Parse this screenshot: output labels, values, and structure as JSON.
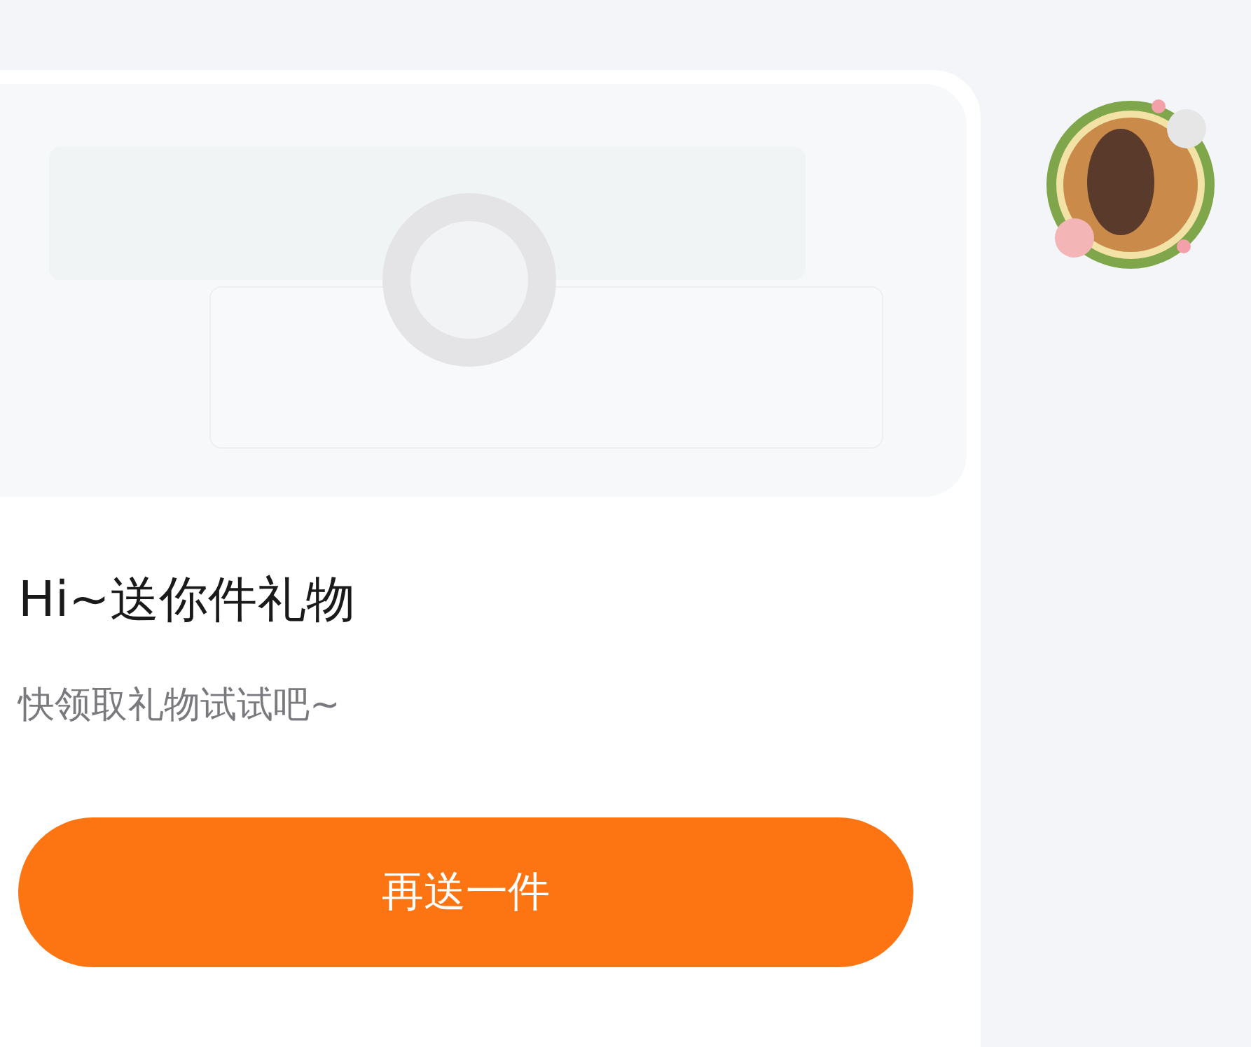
{
  "message": {
    "title": "Hi~送你件礼物",
    "subtitle": "快领取礼物试试吧~",
    "button": "再送一件"
  }
}
